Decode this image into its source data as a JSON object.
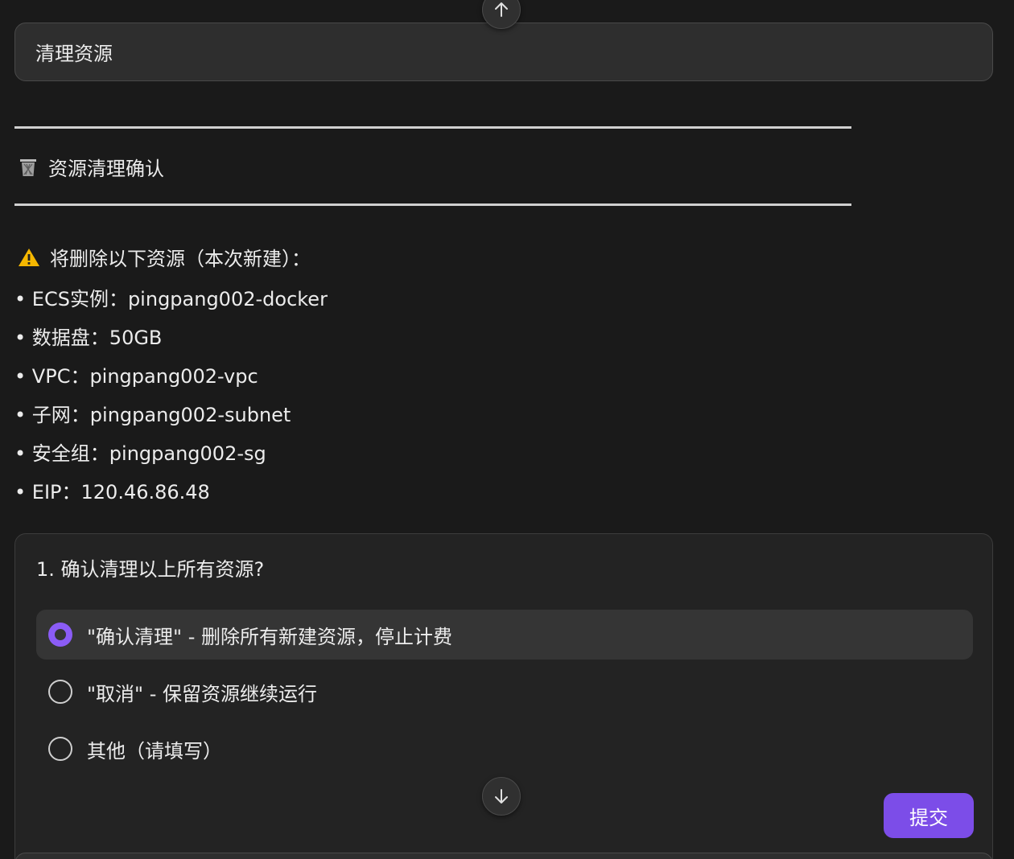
{
  "user_message": {
    "text": "清理资源"
  },
  "section": {
    "icon": "wastebasket-icon",
    "heading": "资源清理确认"
  },
  "warning": {
    "icon": "warning-icon",
    "text": "将删除以下资源（本次新建）："
  },
  "resources": [
    {
      "text": "ECS实例：pingpang002-docker"
    },
    {
      "text": "数据盘：50GB"
    },
    {
      "text": "VPC：pingpang002-vpc"
    },
    {
      "text": "子网：pingpang002-subnet"
    },
    {
      "text": "安全组：pingpang002-sg"
    },
    {
      "text": "EIP：120.46.86.48"
    }
  ],
  "question": {
    "title": "1. 确认清理以上所有资源?",
    "options": [
      {
        "label": "\"确认清理\" - 删除所有新建资源，停止计费",
        "selected": true
      },
      {
        "label": "\"取消\" - 保留资源继续运行",
        "selected": false
      },
      {
        "label": "其他（请填写）",
        "selected": false
      }
    ],
    "submit_label": "提交"
  },
  "colors": {
    "accent": "#7c4de8",
    "radio_selected": "#8b5cf6",
    "background": "#1a1a1a"
  }
}
